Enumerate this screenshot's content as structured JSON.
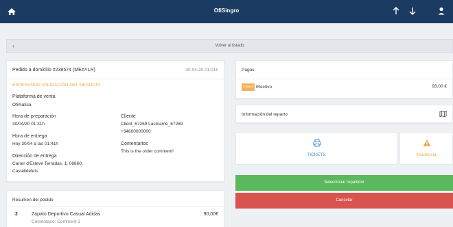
{
  "header": {
    "title": "OfiSingro"
  },
  "back": {
    "label": "Volver al listado"
  },
  "order": {
    "title": "Pedido a domicilio #238574 (MEAYLR)",
    "date": "30-04-20 01:01h",
    "status": "ESPERANDO VALIDACIÓN DEL NEGOCIO",
    "platform_label": "Plataforma de venta",
    "platform_value": "Ofimática",
    "prep_label": "Hora de preparación",
    "prep_value": "30/04/20 01:31h",
    "delivery_label": "Hora de entrega",
    "delivery_value": "Hoy 30/04 a las 01:41h",
    "address_label": "Dirección de entrega",
    "address_line1": "Carrer d'Esteve Terradas, 1, 08860,",
    "address_line2": "Castelldefels",
    "client_label": "Cliente",
    "client_name": "Client_67269 Lastname_67269",
    "client_phone": "+34600000000",
    "comments_label": "Comentarios",
    "comments_value": "This is the order comment!"
  },
  "summary": {
    "title": "Resumen del pedido",
    "items": [
      {
        "qty": "2",
        "name": "Zapato Deportivo Casual Adidas",
        "price": "90,00€",
        "comment": "Comentario: Comment 1"
      }
    ]
  },
  "payments": {
    "title": "Pagos",
    "badge": "COBRAR",
    "method": "Efectivo",
    "amount": "93,00 €"
  },
  "delivery_info": {
    "label": "Información del reparto"
  },
  "actions": {
    "tickets": "TICKETS",
    "incident": "Incidencia",
    "select_driver": "Seleccionar repartidor",
    "cancel": "Cancelar"
  },
  "colors": {
    "topbar": "#1b3b63",
    "accent_orange": "#f0a84a",
    "ticket_blue": "#3f8fd2",
    "green": "#5cb85c",
    "red": "#d9534f"
  }
}
